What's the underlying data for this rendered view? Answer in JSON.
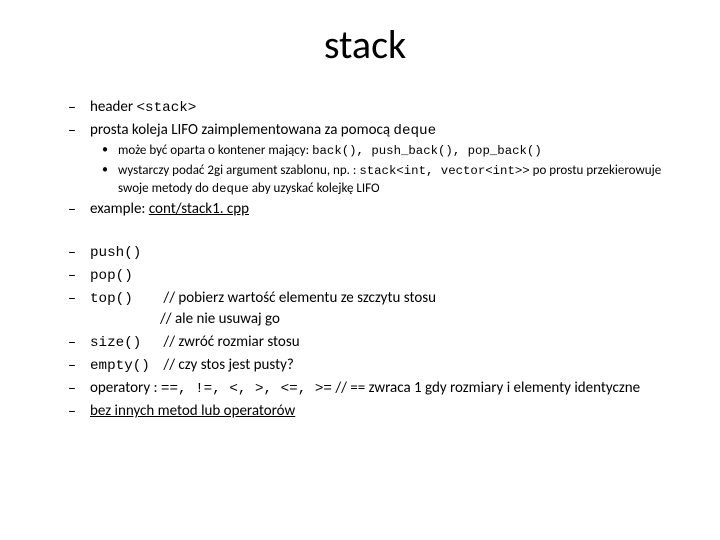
{
  "title": "stack",
  "bullets": {
    "b1_pre": "header ",
    "b1_code": "<stack>",
    "b2_pre": "prosta koleja LIFO zaimplementowana za pomocą ",
    "b2_code": "deque",
    "b2_sub1_pre": "może być oparta o kontener mający: ",
    "b2_sub1_code": "back(), push_back(), pop_back()",
    "b2_sub2_pre": "wystarczy podać 2gi argument szablonu, np. : ",
    "b2_sub2_code": "stack<int, vector<int>>",
    "b2_sub2_post1": " po prostu przekierowuje swoje metody do ",
    "b2_sub2_code2": "deque",
    "b2_sub2_post2": " aby uzyskać kolejkę LIFO",
    "b3_pre": "example: ",
    "b3_link": "cont/stack1. cpp",
    "b4": "push()",
    "b5": "pop()",
    "b6_label": "top()",
    "b6_comment1": "// pobierz wartość elementu ze szczytu stosu",
    "b6_comment2": "// ale nie usuwaj go",
    "b7_label": "size()",
    "b7_comment": "// zwróć rozmiar stosu",
    "b8_label": "empty()",
    "b8_comment": "// czy stos jest pusty?",
    "b9_pre": "operatory : ",
    "b9_code": "==, !=, <, >, <=, >=",
    "b9_comment": "    // == zwraca 1 gdy rozmiary i elementy identyczne",
    "b10": "bez innych metod lub operatorów"
  }
}
